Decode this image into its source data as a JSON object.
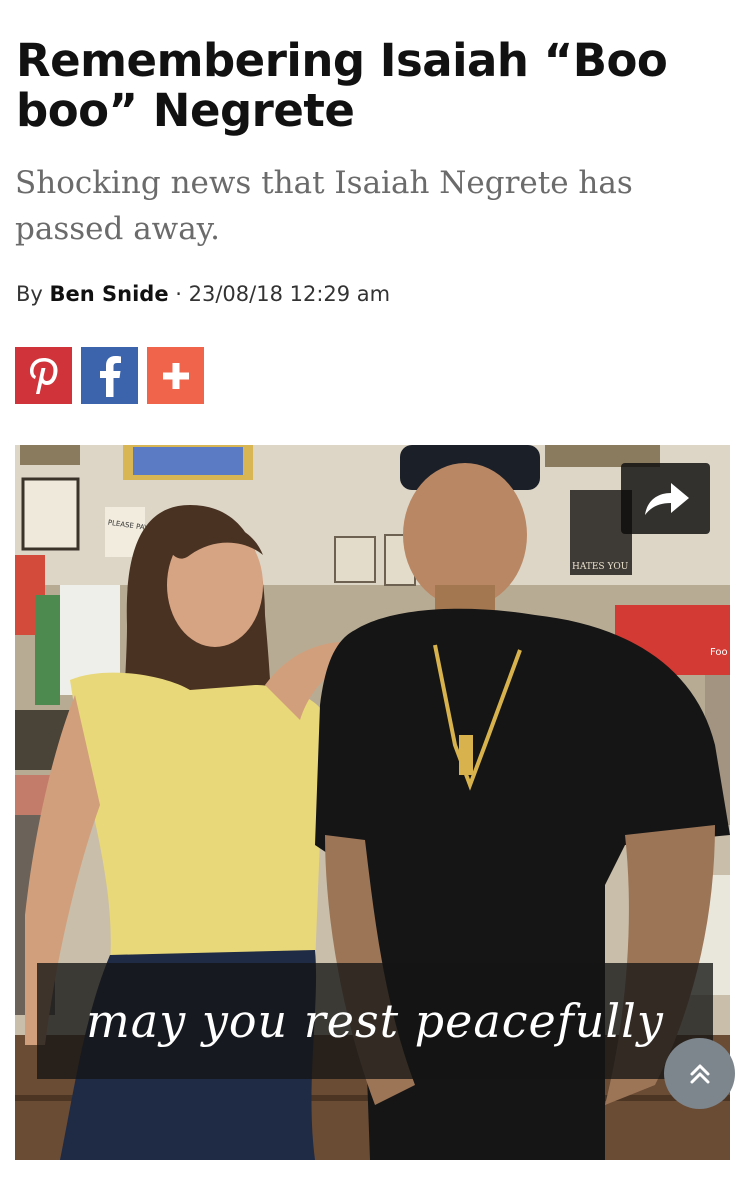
{
  "article": {
    "title": "Remembering Isaiah “Boo boo” Negrete",
    "subtitle": "Shocking news that Isaiah Negrete has passed away.",
    "byline_prefix": "By ",
    "author": "Ben Snide",
    "separator": " · ",
    "timestamp": "23/08/18 12:29 am"
  },
  "share_buttons": [
    {
      "name": "pinterest",
      "icon": "pinterest-icon",
      "color": "#d0343a"
    },
    {
      "name": "facebook",
      "icon": "facebook-icon",
      "color": "#3b64ad"
    },
    {
      "name": "more",
      "icon": "plus-icon",
      "color": "#f0644b"
    }
  ],
  "photo": {
    "caption": "may you rest peacefully",
    "overlay_icon": "share-arrow-icon",
    "sign_please_pay": "PLEASE PAY HERE",
    "sign_hates_you": "HATES YOU",
    "sign_food": "Foo"
  },
  "scroll_top": {
    "icon": "double-chevron-up-icon",
    "color": "#7d868d"
  }
}
